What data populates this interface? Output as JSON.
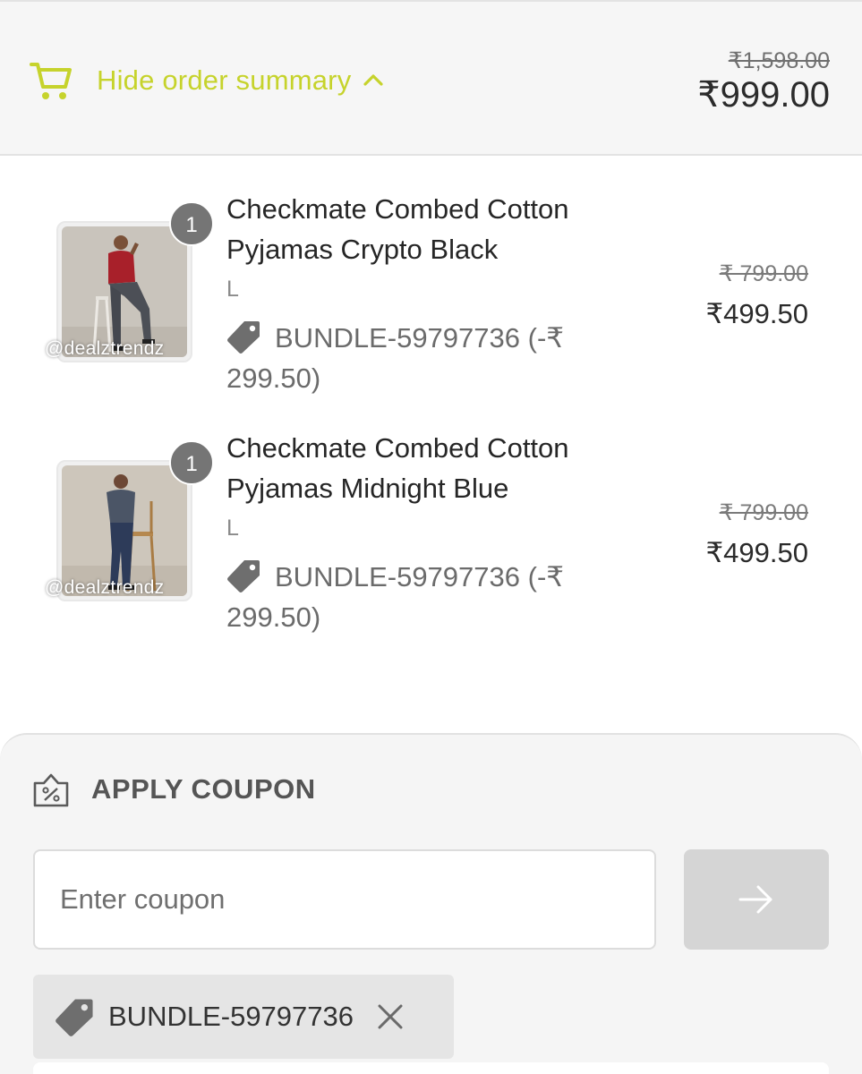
{
  "header": {
    "toggle_label": "Hide order summary",
    "original_total": "₹1,598.00",
    "final_total": "₹999.00",
    "accent_color": "#c6d32c"
  },
  "items": [
    {
      "quantity": "1",
      "title_line1": "Checkmate Combed Cotton",
      "title_line2": "Pyjamas Crypto Black",
      "size": "L",
      "discount_line1": "BUNDLE-59797736 (-₹",
      "discount_line2": "299.50)",
      "original_price": "₹ 799.00",
      "final_price": "₹499.50",
      "watermark": "@dealztrendz"
    },
    {
      "quantity": "1",
      "title_line1": "Checkmate Combed Cotton",
      "title_line2": "Pyjamas Midnight Blue",
      "size": "L",
      "discount_line1": "BUNDLE-59797736 (-₹",
      "discount_line2": "299.50)",
      "original_price": "₹ 799.00",
      "final_price": "₹499.50",
      "watermark": "@dealztrendz"
    }
  ],
  "coupon": {
    "heading": "APPLY COUPON",
    "input_placeholder": "Enter coupon",
    "input_value": "",
    "applied_code": "BUNDLE-59797736"
  },
  "icons": {
    "cart": "cart-icon",
    "toggle": "chevron-up-icon",
    "discount": "tag-icon",
    "coupon": "coupon-percent-icon",
    "apply": "arrow-right-icon",
    "remove": "close-icon"
  }
}
